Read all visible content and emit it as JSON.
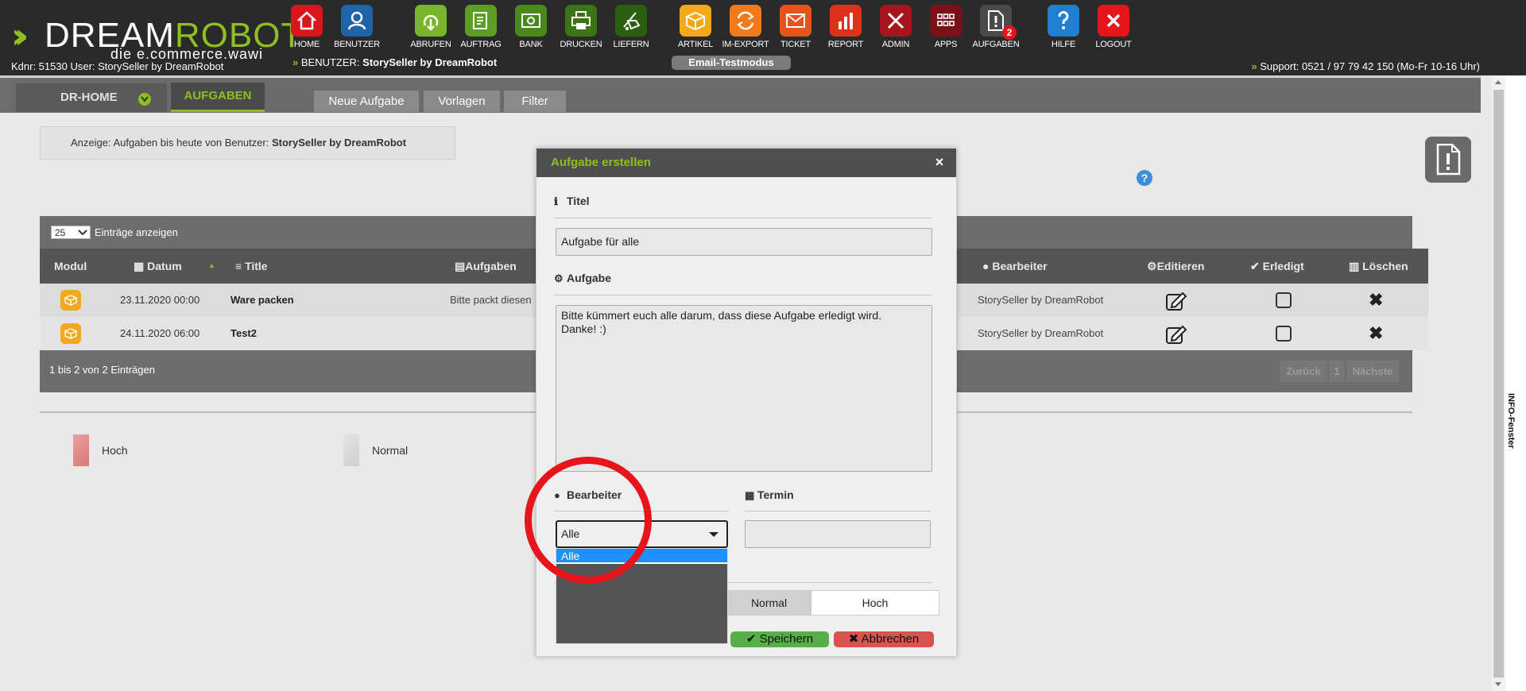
{
  "brand": {
    "logo_word_left": "DREAM",
    "logo_word_right": "ROBOT",
    "logo_sub": "die e.commerce.wawi",
    "kdnr_line": "Kdnr: 51530  User: StorySeller by DreamRobot",
    "user_prefix": "BENUTZER:",
    "user_name": "StorySeller by DreamRobot",
    "mode_badge": "Email-Testmodus",
    "support": "Support: 0521 / 97 79 42 150 (Mo-Fr 10-16 Uhr)",
    "accent": "#8fbf1f"
  },
  "topnav": [
    {
      "label": "HOME",
      "icon": "home-icon",
      "color": "#d9161e"
    },
    {
      "label": "BENUTZER",
      "icon": "user-icon",
      "color": "#1f64a8"
    },
    {
      "label": "ABRUFEN",
      "icon": "download-icon",
      "color": "#79b52a"
    },
    {
      "label": "AUFTRAG",
      "icon": "order-icon",
      "color": "#5d9d23"
    },
    {
      "label": "BANK",
      "icon": "bank-icon",
      "color": "#4a8a1c"
    },
    {
      "label": "DRUCKEN",
      "icon": "print-icon",
      "color": "#3c7515"
    },
    {
      "label": "LIEFERN",
      "icon": "cart-icon",
      "color": "#2d5f10"
    },
    {
      "label": "ARTIKEL",
      "icon": "box-icon",
      "color": "#f4a81c"
    },
    {
      "label": "IM-EXPORT",
      "icon": "sync-icon",
      "color": "#f07a1c"
    },
    {
      "label": "TICKET",
      "icon": "mail-icon",
      "color": "#e8531c"
    },
    {
      "label": "REPORT",
      "icon": "chart-icon",
      "color": "#e1301c"
    },
    {
      "label": "ADMIN",
      "icon": "tools-icon",
      "color": "#a8141c"
    },
    {
      "label": "APPS",
      "icon": "grid-icon",
      "color": "#7a1018"
    },
    {
      "label": "AUFGABEN",
      "icon": "task-icon",
      "color": "#4a4a4a",
      "badge": "2"
    },
    {
      "label": "HILFE",
      "icon": "help-icon",
      "color": "#1f7fd0"
    },
    {
      "label": "LOGOUT",
      "icon": "logout-icon",
      "color": "#e8141c"
    }
  ],
  "subnav": {
    "home_tab": "DR-HOME",
    "active_tab": "AUFGABEN",
    "buttons": [
      "Neue Aufgabe",
      "Vorlagen",
      "Filter"
    ]
  },
  "filter": {
    "prefix": "Anzeige: Aufgaben bis heute von Benutzer:",
    "user": "StorySeller by DreamRobot"
  },
  "table": {
    "page_size": "25",
    "page_size_label": "Einträge anzeigen",
    "headers": {
      "modul": "Modul",
      "datum": "Datum",
      "title": "Title",
      "aufgaben": "Aufgaben",
      "bearbeiter": "Bearbeiter",
      "editieren": "Editieren",
      "erledigt": "Erledigt",
      "loeschen": "Löschen"
    },
    "rows": [
      {
        "datum": "23.11.2020 00:00",
        "title": "Ware packen",
        "aufgabe": "Bitte packt diesen",
        "bearbeiter": "StorySeller by DreamRobot"
      },
      {
        "datum": "24.11.2020 06:00",
        "title": "Test2",
        "aufgabe": "",
        "bearbeiter": "StorySeller by DreamRobot"
      }
    ],
    "info": "1 bis 2 von 2 Einträgen",
    "pagination": {
      "prev": "Zurück",
      "page": "1",
      "next": "Nächste"
    }
  },
  "legend": [
    {
      "label": "Hoch",
      "color": "#e8a0a0"
    },
    {
      "label": "Normal",
      "color": "#d8d8d8"
    }
  ],
  "side_panel": "INFO-Fenster",
  "modal": {
    "title": "Aufgabe erstellen",
    "close": "×",
    "titel_label": "Titel",
    "titel_value": "Aufgabe für alle",
    "aufgabe_label": "Aufgabe",
    "aufgabe_value": "Bitte kümmert euch alle darum, dass diese Aufgabe erledigt wird.\nDanke! :)",
    "bearbeiter_label": "Bearbeiter",
    "bearbeiter_value": "Alle",
    "bearbeiter_options": [
      "Alle"
    ],
    "termin_label": "Termin",
    "termin_value": "",
    "prio_normal": "Normal",
    "prio_hoch": "Hoch",
    "save": "Speichern",
    "cancel": "Abbrechen"
  }
}
